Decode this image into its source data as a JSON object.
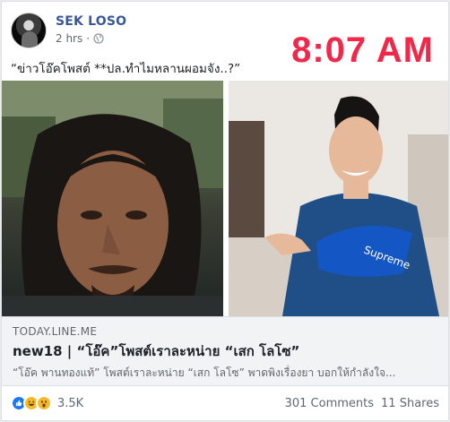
{
  "post": {
    "author": "SEK LOSO",
    "time": "2 hrs",
    "privacy_icon": "globe-icon",
    "overlay_time": "8:07 AM",
    "text": "“ข่าวโอ๊คโพสต์ **ปล.ทำไมหลานผอมจัง..?”"
  },
  "link_preview": {
    "domain": "TODAY.LINE.ME",
    "title": "new18 | “โอ๊ค”โพสต์เราละหน่าย “เสก โลโซ”",
    "description": "“โอ๊ค พานทองแท้” โพสต์เราละหน่าย “เสก โลโซ” พาดพิงเรื่องยา บอกให้กำลังใจ..."
  },
  "stats": {
    "reactions": [
      "like-icon",
      "haha-icon",
      "wow-icon"
    ],
    "reaction_count": "3.5K",
    "comments": "301 Comments",
    "shares": "11 Shares"
  },
  "colors": {
    "author_link": "#385898",
    "overlay_red": "#f02849",
    "like_blue": "#1877f2",
    "emoji_yellow": "#f7b928"
  }
}
